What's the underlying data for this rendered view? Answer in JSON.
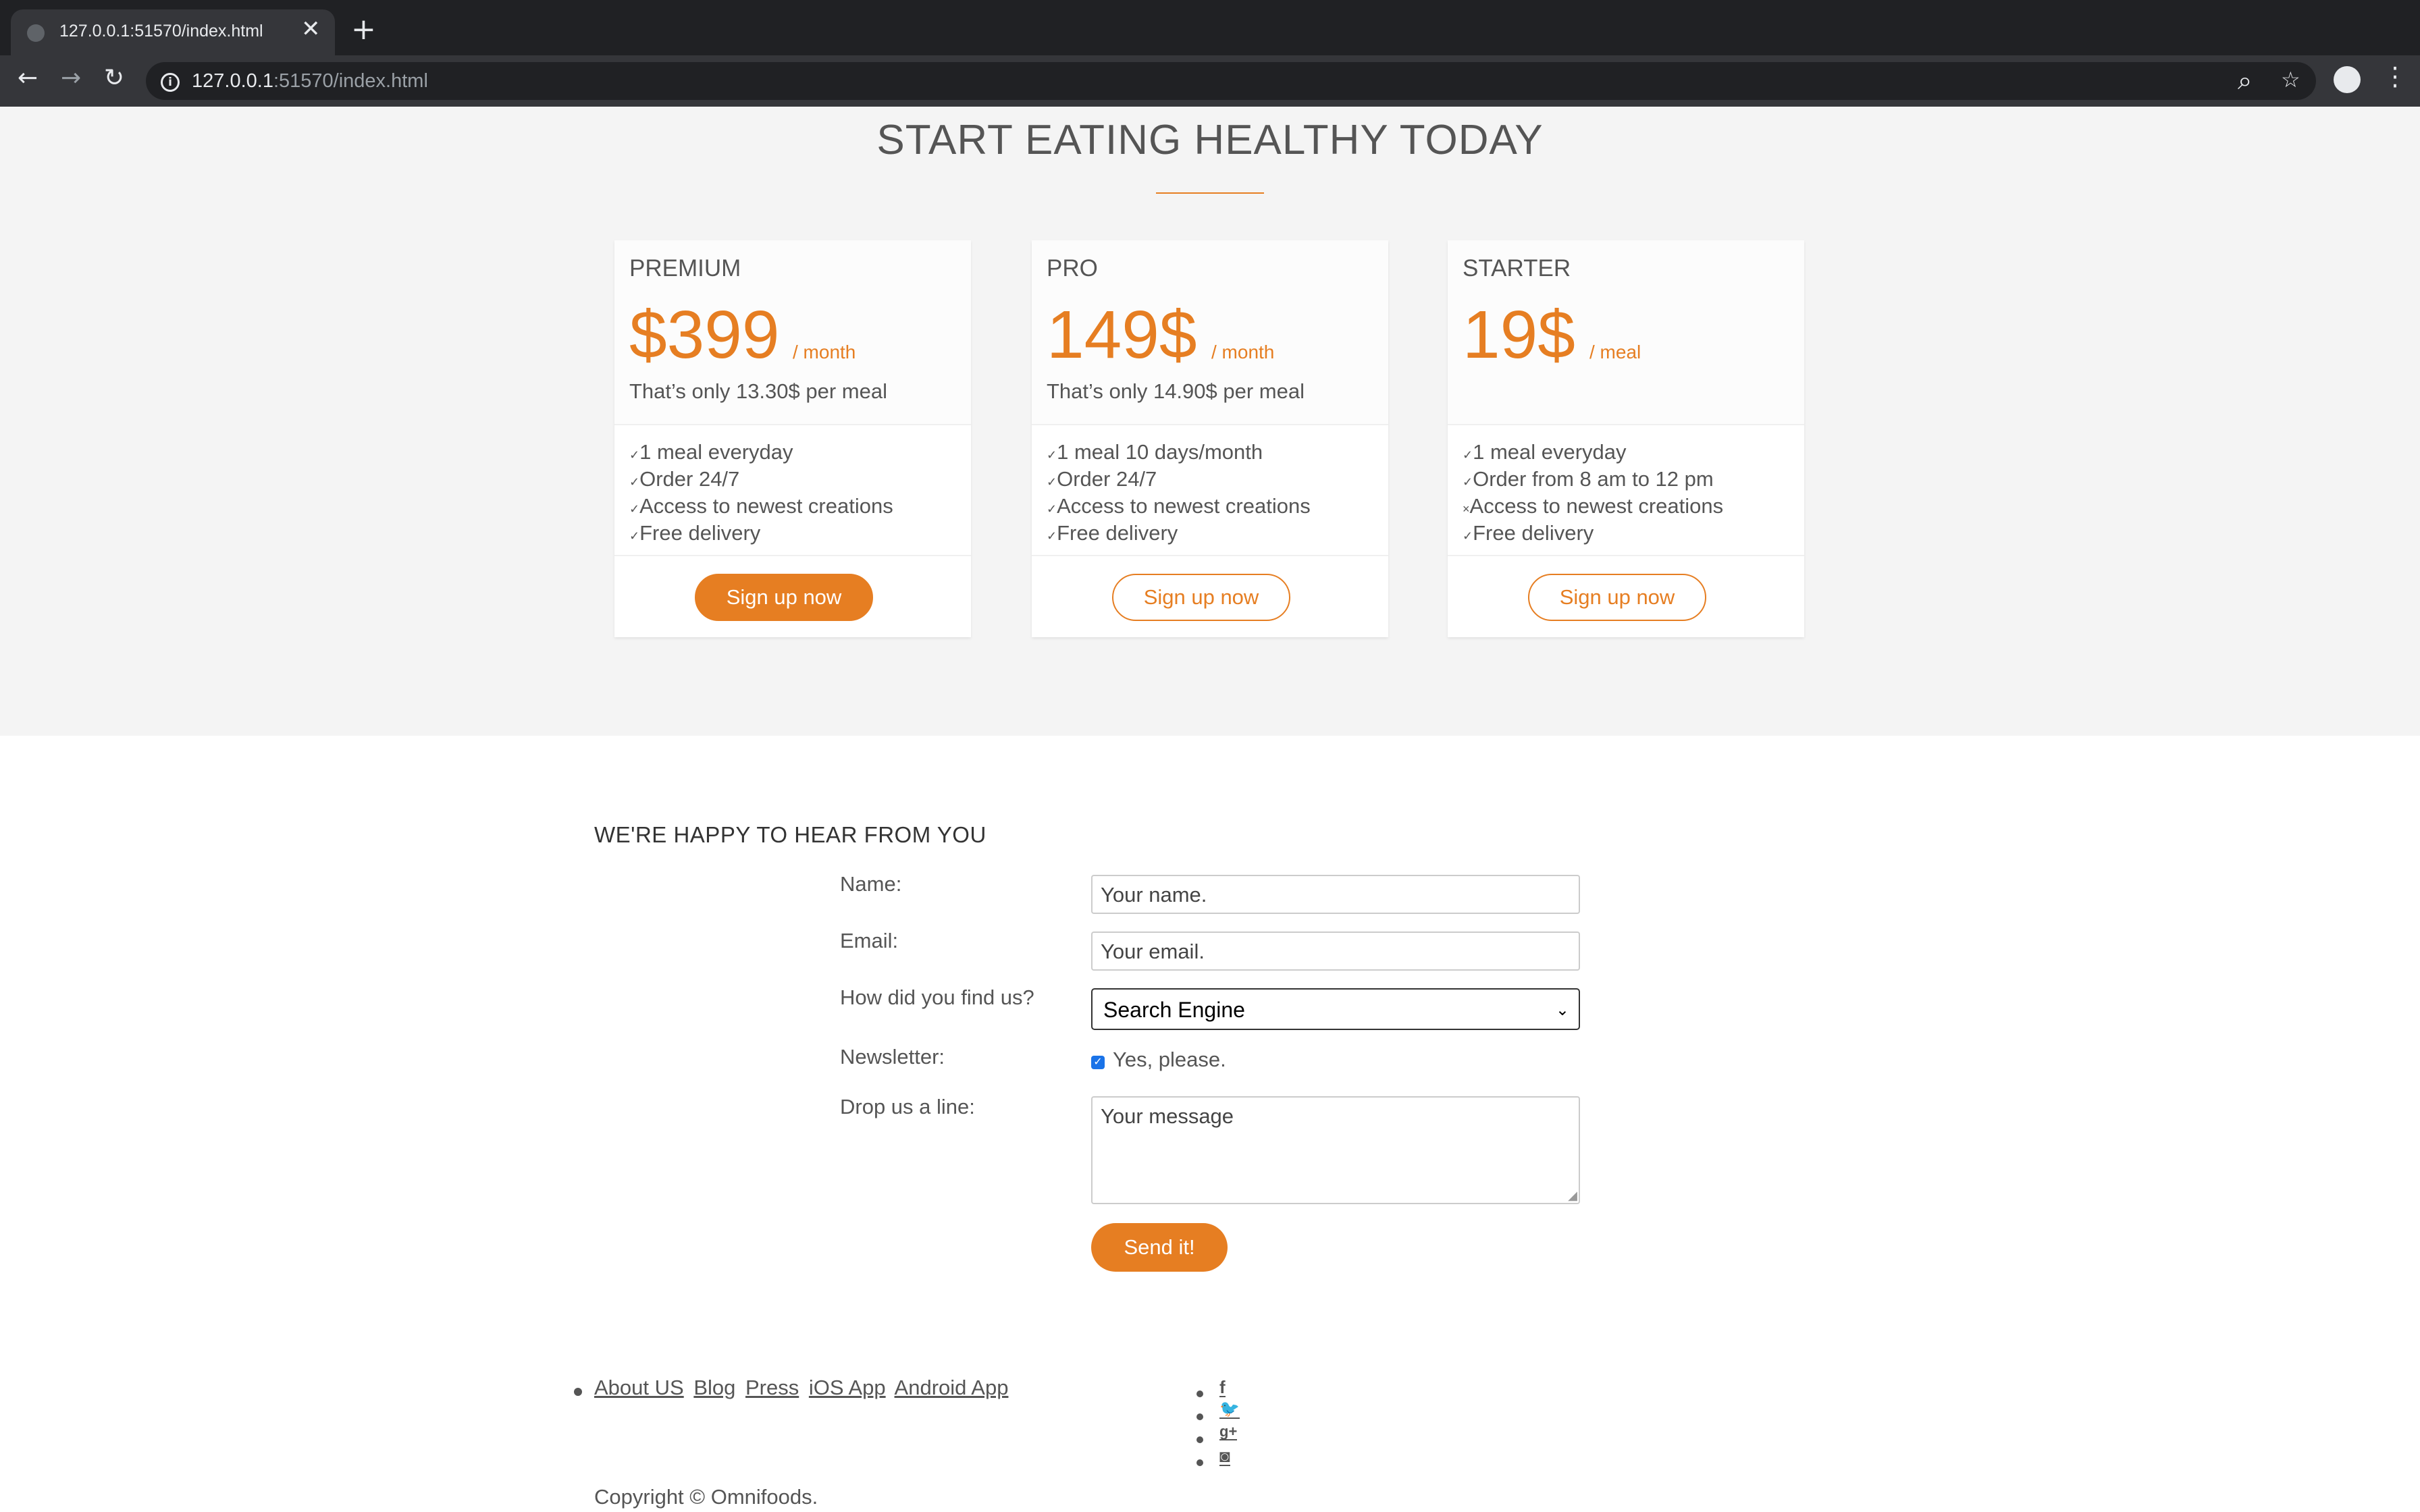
{
  "browser": {
    "tab_title": "127.0.0.1:51570/index.html",
    "tab_close": "✕",
    "new_tab": "+",
    "url_host": "127.0.0.1",
    "url_path": ":51570/index.html",
    "back": "←",
    "forward": "→",
    "reload": "↻",
    "zoom_icon": "⌕",
    "bookmark_icon": "☆",
    "menu_icon": "⋮"
  },
  "plans": {
    "title": "START EATING HEALTHY TODAY",
    "cards": [
      {
        "name": "PREMIUM",
        "price": "$399",
        "unit": "/ month",
        "per_meal": "That’s only 13.30$ per meal",
        "features": [
          {
            "mark": "✓",
            "text": "1 meal everyday"
          },
          {
            "mark": "✓",
            "text": "Order 24/7"
          },
          {
            "mark": "✓",
            "text": "Access to newest creations"
          },
          {
            "mark": "✓",
            "text": "Free delivery"
          }
        ],
        "button": "Sign up now"
      },
      {
        "name": "PRO",
        "price": "149$",
        "unit": "/ month",
        "per_meal": "That’s only 14.90$ per meal",
        "features": [
          {
            "mark": "✓",
            "text": "1 meal 10 days/month"
          },
          {
            "mark": "✓",
            "text": "Order 24/7"
          },
          {
            "mark": "✓",
            "text": "Access to newest creations"
          },
          {
            "mark": "✓",
            "text": "Free delivery"
          }
        ],
        "button": "Sign up now"
      },
      {
        "name": "STARTER",
        "price": "19$",
        "unit": "/ meal",
        "per_meal": "",
        "features": [
          {
            "mark": "✓",
            "text": "1 meal everyday"
          },
          {
            "mark": "✓",
            "text": "Order from 8 am to 12 pm"
          },
          {
            "mark": "×",
            "text": "Access to newest creations"
          },
          {
            "mark": "✓",
            "text": "Free delivery"
          }
        ],
        "button": "Sign up now"
      }
    ]
  },
  "contact": {
    "title": "WE'RE HAPPY TO HEAR FROM YOU",
    "name_label": "Name:",
    "name_placeholder": "Your name.",
    "email_label": "Email:",
    "email_placeholder": "Your email.",
    "find_label": "How did you find us?",
    "find_value": "Search Engine",
    "newsletter_label": "Newsletter:",
    "newsletter_checked": true,
    "newsletter_option": "Yes, please.",
    "message_label": "Drop us a line:",
    "message_placeholder": "Your message",
    "send_button": "Send it!"
  },
  "footer": {
    "links": [
      "About US",
      "Blog",
      "Press",
      "iOS App",
      "Android App"
    ],
    "social": [
      {
        "icon": "facebook-icon",
        "glyph": "f"
      },
      {
        "icon": "twitter-icon",
        "glyph": "🐦"
      },
      {
        "icon": "google-plus-icon",
        "glyph": "g+"
      },
      {
        "icon": "instagram-icon",
        "glyph": "◙"
      }
    ],
    "copyright": "Copyright © Omnifoods."
  },
  "colors": {
    "accent": "#e67e22",
    "section_bg": "#f4f4f4",
    "text": "#555555"
  }
}
